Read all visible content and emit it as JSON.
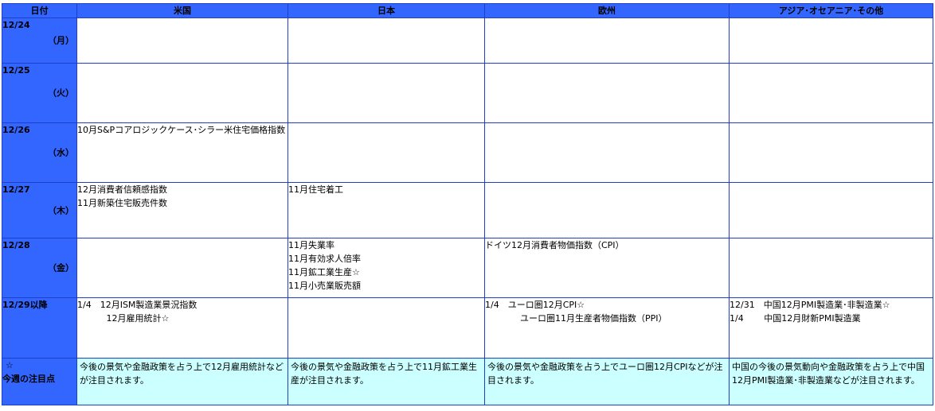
{
  "headers": {
    "date": "日付",
    "us": "米国",
    "jp": "日本",
    "eu": "欧州",
    "asia": "アジア･オセアニア･その他"
  },
  "rows": [
    {
      "date": "12/24",
      "weekday": "（月）",
      "us": [],
      "jp": [],
      "eu": [],
      "asia": []
    },
    {
      "date": "12/25",
      "weekday": "（火）",
      "us": [],
      "jp": [],
      "eu": [],
      "asia": []
    },
    {
      "date": "12/26",
      "weekday": "（水）",
      "us": [
        "10月S&Pコアロジックケース･シラー米住宅価格指数"
      ],
      "jp": [],
      "eu": [],
      "asia": []
    },
    {
      "date": "12/27",
      "weekday": "（木）",
      "us": [
        "12月消費者信頼感指数",
        "11月新築住宅販売件数"
      ],
      "jp": [
        "11月住宅着工"
      ],
      "eu": [],
      "asia": []
    },
    {
      "date": "12/28",
      "weekday": "（金）",
      "us": [],
      "jp": [
        "11月失業率",
        "11月有効求人倍率",
        "11月鉱工業生産☆",
        "11月小売業販売額"
      ],
      "eu": [
        "ドイツ12月消費者物価指数（CPI）"
      ],
      "asia": []
    },
    {
      "date": "12/29以降",
      "weekday": "",
      "us": [
        "1/4　12月ISM製造業景況指数",
        "　　 　12月雇用統計☆"
      ],
      "jp": [],
      "eu": [
        "1/4　ユーロ圏12月CPI☆",
        "　　　　ユーロ圏11月生産者物価指数（PPI）"
      ],
      "asia": [
        "12/31　中国12月PMI製造業･非製造業☆",
        "1/4　 　中国12月財新PMI製造業"
      ]
    }
  ],
  "focus": {
    "star": "☆",
    "label": "今週の注目点",
    "us": "今後の景気や金融政策を占う上で12月雇用統計などが注目されます。",
    "jp": "今後の景気や金融政策を占う上で11月鉱工業生産が注目されます。",
    "eu": "今後の景気や金融政策を占う上でユーロ圏12月CPIなどが注目されます。",
    "asia": "中国の今後の景気動向や金融政策を占う上で中国12月PMI製造業･非製造業などが注目されます。"
  }
}
